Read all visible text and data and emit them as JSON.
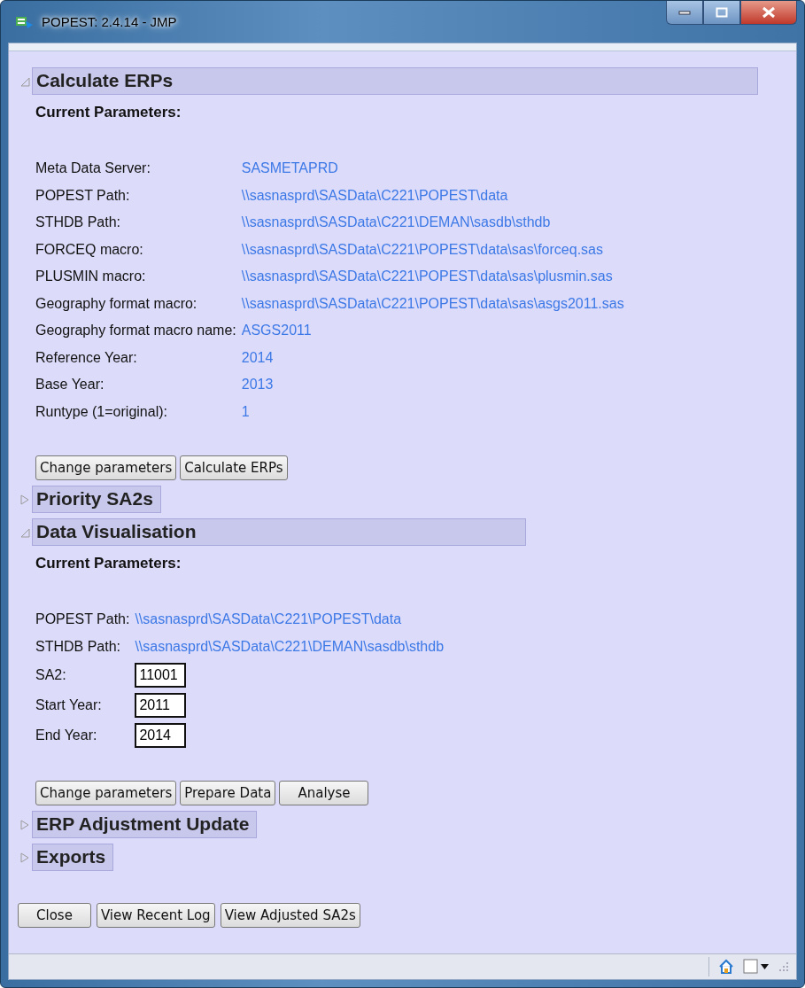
{
  "window": {
    "title": "POPEST: 2.4.14 - JMP"
  },
  "sections": [
    {
      "title": "Calculate ERPs",
      "expanded": true,
      "subtitle": "Current Parameters:",
      "params": [
        {
          "kind": "link",
          "label": "Meta Data Server:",
          "value": "SASMETAPRD"
        },
        {
          "kind": "link",
          "label": "POPEST Path:",
          "value": "\\\\sasnasprd\\SASData\\C221\\POPEST\\data"
        },
        {
          "kind": "link",
          "label": "STHDB Path:",
          "value": "\\\\sasnasprd\\SASData\\C221\\DEMAN\\sasdb\\sthdb"
        },
        {
          "kind": "link",
          "label": "FORCEQ macro:",
          "value": "\\\\sasnasprd\\SASData\\C221\\POPEST\\data\\sas\\forceq.sas"
        },
        {
          "kind": "link",
          "label": "PLUSMIN macro:",
          "value": "\\\\sasnasprd\\SASData\\C221\\POPEST\\data\\sas\\plusmin.sas"
        },
        {
          "kind": "link",
          "label": "Geography format macro:",
          "value": "\\\\sasnasprd\\SASData\\C221\\POPEST\\data\\sas\\asgs2011.sas"
        },
        {
          "kind": "link",
          "label": "Geography format macro name:",
          "value": "ASGS2011"
        },
        {
          "kind": "link",
          "label": "Reference Year:",
          "value": "2014"
        },
        {
          "kind": "link",
          "label": "Base Year:",
          "value": "2013"
        },
        {
          "kind": "link",
          "label": "Runtype (1=original):",
          "value": "1"
        }
      ],
      "buttons": [
        "Change parameters",
        "Calculate ERPs"
      ]
    },
    {
      "title": "Priority SA2s",
      "expanded": false
    },
    {
      "title": "Data Visualisation",
      "expanded": true,
      "subtitle": "Current Parameters:",
      "params": [
        {
          "kind": "link",
          "label": "POPEST Path:",
          "value": "\\\\sasnasprd\\SASData\\C221\\POPEST\\data"
        },
        {
          "kind": "link",
          "label": "STHDB Path:",
          "value": "\\\\sasnasprd\\SASData\\C221\\DEMAN\\sasdb\\sthdb"
        },
        {
          "kind": "input",
          "label": "SA2:",
          "value": "11001"
        },
        {
          "kind": "input",
          "label": "Start Year:",
          "value": "2011"
        },
        {
          "kind": "input",
          "label": "End Year:",
          "value": "2014"
        }
      ],
      "buttons": [
        "Change parameters",
        "Prepare Data",
        "Analyse"
      ]
    },
    {
      "title": "ERP Adjustment Update",
      "expanded": false
    },
    {
      "title": "Exports",
      "expanded": false
    }
  ],
  "buttons": [
    "Close",
    "View Recent Log",
    "View Adjusted SA2s"
  ]
}
